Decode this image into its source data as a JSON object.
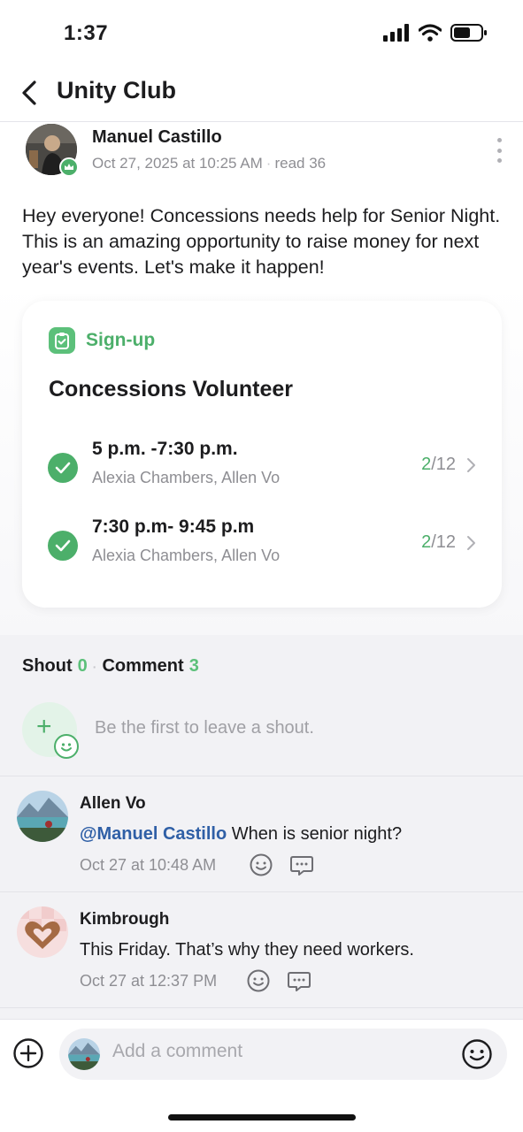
{
  "status_bar": {
    "time": "1:37"
  },
  "nav": {
    "title": "Unity Club"
  },
  "post": {
    "author": "Manuel Castillo",
    "date": "Oct 27, 2025 at 10:25 AM",
    "read": "read 36",
    "body": "Hey everyone! Concessions needs help for Senior Night. This is an amazing opportunity to raise money for next year's events. Let's make it happen!"
  },
  "signup": {
    "tag": "Sign-up",
    "title": "Concessions Volunteer",
    "slots": [
      {
        "time": "5 p.m. -7:30 p.m.",
        "names": "Alexia Chambers, Allen Vo",
        "filled": "2",
        "total": "/12"
      },
      {
        "time": "7:30 p.m- 9:45 p.m",
        "names": "Alexia Chambers, Allen Vo",
        "filled": "2",
        "total": "/12"
      }
    ]
  },
  "tabs": {
    "shout_label": "Shout",
    "shout_count": "0",
    "comment_label": "Comment",
    "comment_count": "3"
  },
  "shout": {
    "hint": "Be the first to leave a shout."
  },
  "comments": [
    {
      "name": "Allen Vo",
      "mention": "@Manuel Castillo",
      "text": " When is senior night?",
      "time": "Oct 27 at 10:48 AM"
    },
    {
      "name": "Kimbrough",
      "mention": "",
      "text": "This Friday. That’s why they need workers.",
      "time": "Oct 27 at 12:37 PM"
    }
  ],
  "composer": {
    "placeholder": "Add a comment"
  },
  "colors": {
    "accent_green": "#4caf6a",
    "mention_blue": "#2f5fa6",
    "muted_gray": "#8e8e93"
  },
  "icons": [
    "back-chevron-icon",
    "admin-crown-icon",
    "more-dots-icon",
    "clipboard-check-icon",
    "check-circle-icon",
    "chevron-right-icon",
    "add-shout-icon",
    "smile-react-icon",
    "reply-bubble-icon",
    "plus-circle-icon",
    "emoji-icon"
  ]
}
